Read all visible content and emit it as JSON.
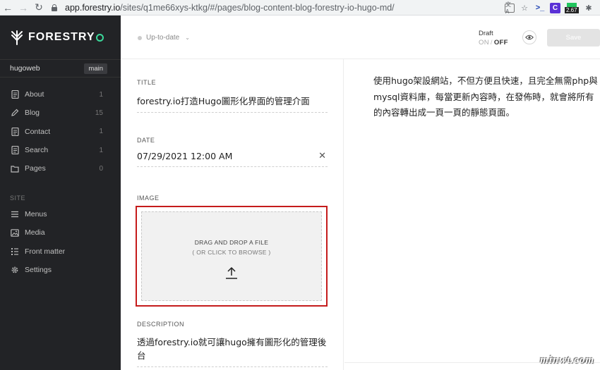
{
  "browser": {
    "url_domain": "app.forestry.io",
    "url_path": "/sites/q1me66xys-ktkg/#/pages/blog-content-blog-forestry-io-hugo-md/",
    "extension_badge": "2.67",
    "extension_c": "C"
  },
  "sidebar": {
    "brand": "FORESTRY",
    "site_name": "hugoweb",
    "branch": "main",
    "items": [
      {
        "label": "About",
        "count": "1",
        "icon": "page-icon"
      },
      {
        "label": "Blog",
        "count": "15",
        "icon": "pencil-icon"
      },
      {
        "label": "Contact",
        "count": "1",
        "icon": "page-icon"
      },
      {
        "label": "Search",
        "count": "1",
        "icon": "page-icon"
      },
      {
        "label": "Pages",
        "count": "0",
        "icon": "folder-icon"
      }
    ],
    "section_title": "SITE",
    "site_items": [
      {
        "label": "Menus",
        "icon": "menu-icon"
      },
      {
        "label": "Media",
        "icon": "image-icon"
      },
      {
        "label": "Front matter",
        "icon": "front-matter-icon"
      },
      {
        "label": "Settings",
        "icon": "gear-icon"
      }
    ]
  },
  "topbar": {
    "sync_status": "Up-to-date",
    "draft_label": "Draft",
    "toggle_on": "ON",
    "toggle_sep": "/",
    "toggle_off": "OFF",
    "save_label": "Save"
  },
  "form": {
    "title_label": "TITLE",
    "title_value": "forestry.io打造Hugo圖形化界面的管理介面",
    "date_label": "DATE",
    "date_value": "07/29/2021 12:00 AM",
    "image_label": "IMAGE",
    "drop_title": "DRAG AND DROP A FILE",
    "drop_sub": "( OR CLICK TO BROWSE )",
    "description_label": "DESCRIPTION",
    "description_value": "透過forestry.io就可讓hugo擁有圖形化的管理後台"
  },
  "content": {
    "body": "使用hugo架設網站，不但方便且快速，且完全無需php與mysql資料庫，每當更新內容時，在發佈時，就會將所有的內容轉出成一頁一頁的靜態頁面。"
  },
  "watermark": "minwt.com",
  "colors": {
    "sidebar_bg": "#222326",
    "status_green": "#3bd89a",
    "highlight_red": "#c51b1b"
  }
}
